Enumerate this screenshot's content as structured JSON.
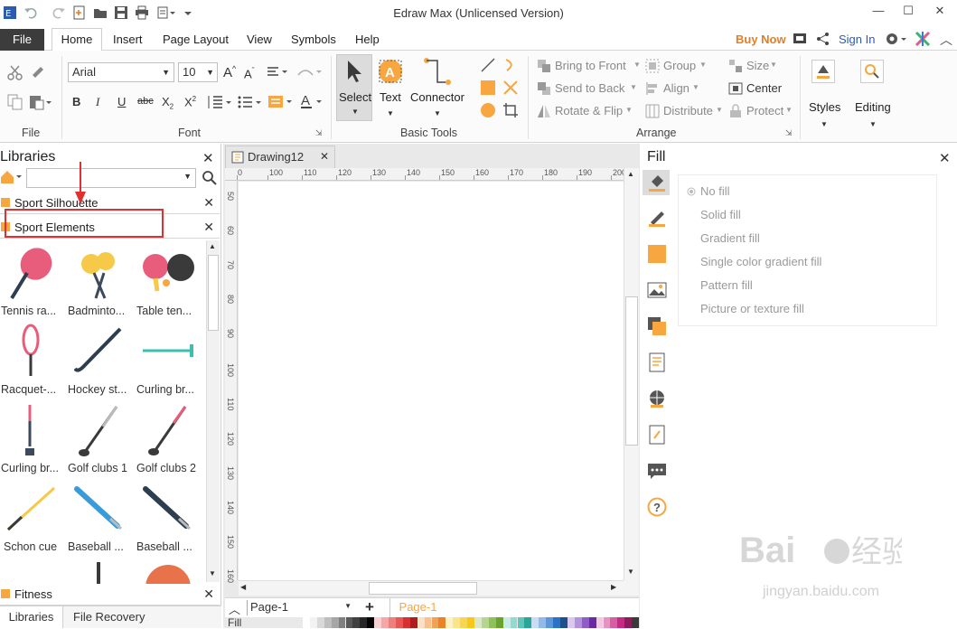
{
  "window": {
    "title": "Edraw Max (Unlicensed Version)",
    "min_glyph": "—",
    "max_glyph": "☐",
    "close_glyph": "✕"
  },
  "menu": {
    "file": "File",
    "tabs": [
      "Home",
      "Insert",
      "Page Layout",
      "View",
      "Symbols",
      "Help"
    ],
    "buy_now": "Buy Now",
    "sign_in": "Sign In"
  },
  "ribbon": {
    "font_group": {
      "label": "Font",
      "font_name": "Arial",
      "font_size": "10"
    },
    "file_group": {
      "label": "File"
    },
    "basic_tools": {
      "label": "Basic Tools",
      "select": "Select",
      "text": "Text",
      "connector": "Connector"
    },
    "arrange": {
      "label": "Arrange",
      "bring_to_front": "Bring to Front",
      "send_to_back": "Send to Back",
      "rotate_flip": "Rotate & Flip",
      "group": "Group",
      "align": "Align",
      "distribute": "Distribute",
      "size": "Size",
      "center": "Center",
      "protect": "Protect"
    },
    "styles": "Styles",
    "editing": "Editing"
  },
  "libraries": {
    "title": "Libraries",
    "search_value": "",
    "open": [
      {
        "name": "Sport Silhouette"
      },
      {
        "name": "Sport Elements"
      }
    ],
    "shapes": [
      "Tennis ra...",
      "Badminto...",
      "Table ten...",
      "Racquet-...",
      "Hockey st...",
      "Curling br...",
      "Curling br...",
      "Golf clubs 1",
      "Golf clubs 2",
      "Schon cue",
      "Baseball ...",
      "Baseball ..."
    ],
    "collapsed": "Fitness",
    "bottom_tabs": [
      "Libraries",
      "File Recovery"
    ]
  },
  "document": {
    "tab_title": "Drawing12",
    "ruler_h": [
      "0",
      "100",
      "110",
      "120",
      "130",
      "140",
      "150",
      "160",
      "170",
      "180",
      "190",
      "200"
    ],
    "ruler_v": [
      "50",
      "60",
      "70",
      "80",
      "90",
      "100",
      "110",
      "120",
      "130",
      "140",
      "150",
      "160"
    ],
    "page_select": "Page-1",
    "active_page": "Page-1",
    "fill_label": "Fill"
  },
  "fill_panel": {
    "title": "Fill",
    "options": [
      "No fill",
      "Solid fill",
      "Gradient fill",
      "Single color gradient fill",
      "Pattern fill",
      "Picture or texture fill"
    ],
    "selected": "No fill"
  },
  "colors": {
    "accent_orange": "#f7a640",
    "red_highlight": "#e03030",
    "file_tab_bg": "#3c3c3c"
  }
}
